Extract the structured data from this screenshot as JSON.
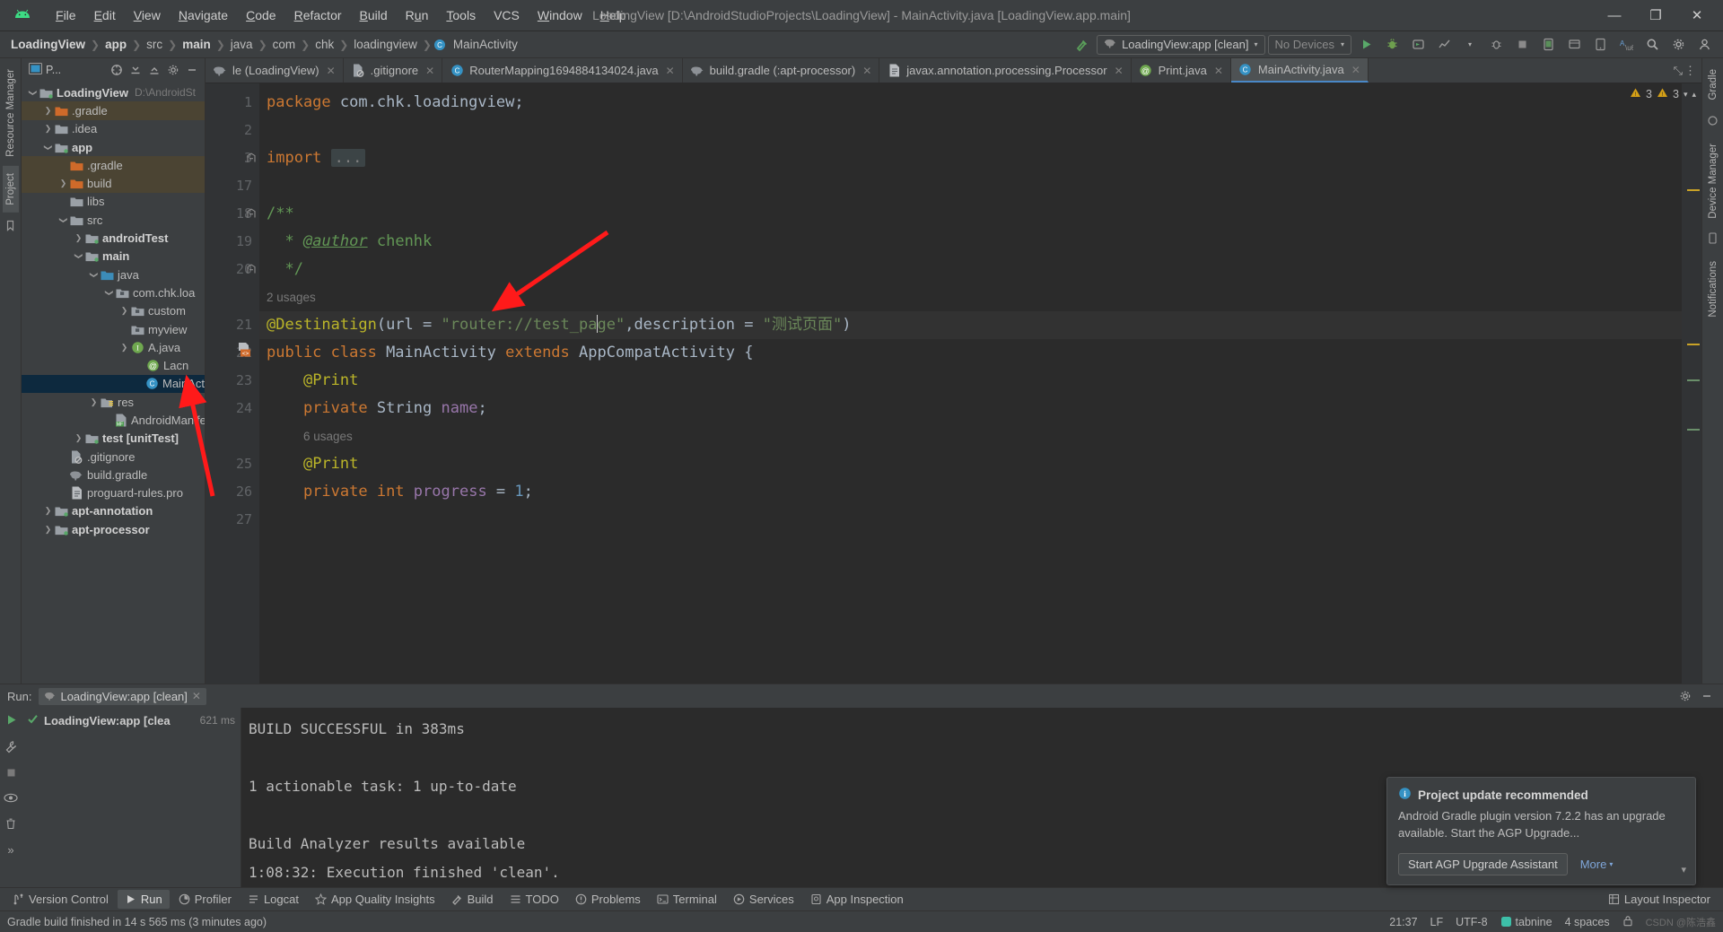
{
  "window": {
    "title": "LoadingView [D:\\AndroidStudioProjects\\LoadingView] - MainActivity.java [LoadingView.app.main]",
    "minimize": "—",
    "maximize": "❐",
    "close": "✕"
  },
  "menu": [
    "File",
    "Edit",
    "View",
    "Navigate",
    "Code",
    "Refactor",
    "Build",
    "Run",
    "Tools",
    "VCS",
    "Window",
    "Help"
  ],
  "breadcrumbs": [
    {
      "label": "LoadingView",
      "bold": true
    },
    {
      "label": "app",
      "bold": true
    },
    {
      "label": "src",
      "bold": false
    },
    {
      "label": "main",
      "bold": true
    },
    {
      "label": "java",
      "bold": false
    },
    {
      "label": "com",
      "bold": false
    },
    {
      "label": "chk",
      "bold": false
    },
    {
      "label": "loadingview",
      "bold": false
    },
    {
      "label": "MainActivity",
      "bold": false,
      "icon": "class-icon"
    }
  ],
  "toolbar": {
    "run_config": "LoadingView:app [clean]",
    "device": "No Devices",
    "caret": "▾"
  },
  "project_panel": {
    "title": "P...",
    "tree": [
      {
        "depth": 0,
        "arrow": "⌄",
        "label": "LoadingView",
        "bold": true,
        "icon": "module-icon",
        "sub": "D:\\AndroidSt",
        "state": "normal"
      },
      {
        "depth": 1,
        "arrow": "›",
        "label": ".gradle",
        "bold": false,
        "icon": "folder-orange",
        "state": "gradle"
      },
      {
        "depth": 1,
        "arrow": "›",
        "label": ".idea",
        "bold": false,
        "icon": "folder-gray",
        "state": "normal"
      },
      {
        "depth": 1,
        "arrow": "⌄",
        "label": "app",
        "bold": true,
        "icon": "module-icon",
        "state": "normal"
      },
      {
        "depth": 2,
        "arrow": "",
        "label": ".gradle",
        "bold": false,
        "icon": "folder-orange",
        "state": "gradle"
      },
      {
        "depth": 2,
        "arrow": "›",
        "label": "build",
        "bold": false,
        "icon": "folder-orange",
        "state": "gradle"
      },
      {
        "depth": 2,
        "arrow": "",
        "label": "libs",
        "bold": false,
        "icon": "folder-gray",
        "state": "normal"
      },
      {
        "depth": 2,
        "arrow": "⌄",
        "label": "src",
        "bold": false,
        "icon": "folder-gray",
        "state": "normal"
      },
      {
        "depth": 3,
        "arrow": "›",
        "label": "androidTest",
        "bold": true,
        "icon": "module-icon",
        "state": "normal"
      },
      {
        "depth": 3,
        "arrow": "⌄",
        "label": "main",
        "bold": true,
        "icon": "module-icon",
        "state": "normal"
      },
      {
        "depth": 4,
        "arrow": "⌄",
        "label": "java",
        "bold": false,
        "icon": "folder-blue",
        "state": "normal"
      },
      {
        "depth": 5,
        "arrow": "⌄",
        "label": "com.chk.loa",
        "bold": false,
        "icon": "package-icon",
        "state": "normal"
      },
      {
        "depth": 6,
        "arrow": "›",
        "label": "custom",
        "bold": false,
        "icon": "package-icon",
        "state": "normal"
      },
      {
        "depth": 6,
        "arrow": "",
        "label": "myview",
        "bold": false,
        "icon": "package-icon",
        "state": "normal"
      },
      {
        "depth": 6,
        "arrow": "›",
        "label": "A.java",
        "bold": false,
        "icon": "interface-icon",
        "state": "normal"
      },
      {
        "depth": 7,
        "arrow": "",
        "label": "Lacn",
        "bold": false,
        "icon": "annotation-icon",
        "state": "normal"
      },
      {
        "depth": 7,
        "arrow": "",
        "label": "MainActi",
        "bold": false,
        "icon": "class-icon",
        "state": "selected"
      },
      {
        "depth": 4,
        "arrow": "›",
        "label": "res",
        "bold": false,
        "icon": "res-icon",
        "state": "normal"
      },
      {
        "depth": 5,
        "arrow": "",
        "label": "AndroidManife",
        "bold": false,
        "icon": "manifest-icon",
        "state": "normal"
      },
      {
        "depth": 3,
        "arrow": "›",
        "label": "test [unitTest]",
        "bold": true,
        "icon": "module-icon",
        "state": "normal"
      },
      {
        "depth": 2,
        "arrow": "",
        "label": ".gitignore",
        "bold": false,
        "icon": "gitignore-icon",
        "state": "normal"
      },
      {
        "depth": 2,
        "arrow": "",
        "label": "build.gradle",
        "bold": false,
        "icon": "gradle-icon",
        "state": "normal"
      },
      {
        "depth": 2,
        "arrow": "",
        "label": "proguard-rules.pro",
        "bold": false,
        "icon": "file-icon",
        "state": "normal"
      },
      {
        "depth": 1,
        "arrow": "›",
        "label": "apt-annotation",
        "bold": true,
        "icon": "module-icon",
        "state": "normal"
      },
      {
        "depth": 1,
        "arrow": "›",
        "label": "apt-processor",
        "bold": true,
        "icon": "module-icon",
        "state": "normal"
      }
    ]
  },
  "left_strip": [
    "Resource Manager",
    "Project"
  ],
  "right_strip": [
    "Gradle",
    "Device Manager",
    "Notifications"
  ],
  "editor_tabs": [
    {
      "label": "le (LoadingView)",
      "icon": "gradle-icon",
      "active": false
    },
    {
      "label": ".gitignore",
      "icon": "gitignore-icon",
      "active": false
    },
    {
      "label": "RouterMapping1694884134024.java",
      "icon": "class-icon",
      "active": false
    },
    {
      "label": "build.gradle (:apt-processor)",
      "icon": "gradle-icon",
      "active": false
    },
    {
      "label": "javax.annotation.processing.Processor",
      "icon": "file-icon",
      "active": false
    },
    {
      "label": "Print.java",
      "icon": "annotation-icon",
      "active": false
    },
    {
      "label": "MainActivity.java",
      "icon": "class-icon",
      "active": true
    }
  ],
  "editor": {
    "warnings_count": "3",
    "errors_count": "3",
    "lines": [
      {
        "num": "1",
        "html": "<span class='kw'>package</span> com.chk.loadingview;"
      },
      {
        "num": "2",
        "html": ""
      },
      {
        "num": "3",
        "html": "<span class='kw'>import</span> <span class='fold-box'>...</span>"
      },
      {
        "num": "17",
        "html": ""
      },
      {
        "num": "18",
        "html": "<span class='cmt'>/**</span>"
      },
      {
        "num": "19",
        "html": "  <span class='cmt'>* <i><u>@author</u></i> chenhk</span>"
      },
      {
        "num": "20",
        "html": "  <span class='cmt'>*/</span>"
      },
      {
        "num": "",
        "html": "<span class='usages'>2 usages</span>"
      },
      {
        "num": "21",
        "html": "<span class='anno'>@Destinatign</span>(url = <span class='str'>\"router://test_pa</span>|<span class='str'>ge\"</span>,description = <span class='str'>\"测试页面\"</span>)",
        "highlighted": true
      },
      {
        "num": "22",
        "html": "<span class='kw'>public class</span> MainActivity <span class='kw'>extends</span> <span class='cls'>AppCompatActivity</span> {"
      },
      {
        "num": "23",
        "html": "    <span class='anno'>@Print</span>"
      },
      {
        "num": "24",
        "html": "    <span class='kw'>private</span> <span class='cls'>String</span> <span class='fld'>name</span>;"
      },
      {
        "num": "",
        "html": "    <span class='usages'>6 usages</span>"
      },
      {
        "num": "25",
        "html": "    <span class='anno'>@Print</span>"
      },
      {
        "num": "26",
        "html": "    <span class='kw'>private int</span> <span class='fld'>progress</span> = <span class='num'>1</span>;"
      },
      {
        "num": "27",
        "html": ""
      }
    ]
  },
  "run_panel": {
    "run_label": "Run:",
    "tab_label": "LoadingView:app [clean]",
    "tree_item": "LoadingView:app [clea",
    "tree_time": "621 ms",
    "console": [
      "BUILD SUCCESSFUL in 383ms",
      "",
      "1 actionable task: 1 up-to-date",
      "",
      "Build Analyzer results available",
      "1:08:32: Execution finished 'clean'."
    ]
  },
  "notification": {
    "title": "Project update recommended",
    "body": "Android Gradle plugin version 7.2.2 has an upgrade available. Start the AGP Upgrade...",
    "primary_button": "Start AGP Upgrade Assistant",
    "more_label": "More",
    "more_caret": "▾"
  },
  "bottom_tools": [
    {
      "label": "Version Control",
      "icon": "vcs-icon",
      "selected": false
    },
    {
      "label": "Run",
      "icon": "run-icon",
      "selected": true
    },
    {
      "label": "Profiler",
      "icon": "profiler-icon",
      "selected": false
    },
    {
      "label": "Logcat",
      "icon": "logcat-icon",
      "selected": false
    },
    {
      "label": "App Quality Insights",
      "icon": "insights-icon",
      "selected": false
    },
    {
      "label": "Build",
      "icon": "build-icon",
      "selected": false
    },
    {
      "label": "TODO",
      "icon": "todo-icon",
      "selected": false
    },
    {
      "label": "Problems",
      "icon": "problems-icon",
      "selected": false
    },
    {
      "label": "Terminal",
      "icon": "terminal-icon",
      "selected": false
    },
    {
      "label": "Services",
      "icon": "services-icon",
      "selected": false
    },
    {
      "label": "App Inspection",
      "icon": "inspection-icon",
      "selected": false
    }
  ],
  "bottom_tools_right": [
    {
      "label": "Layout Inspector",
      "icon": "layout-inspector-icon"
    }
  ],
  "statusbar": {
    "message": "Gradle build finished in 14 s 565 ms (3 minutes ago)",
    "time": "21:37",
    "line_sep": "LF",
    "encoding": "UTF-8",
    "plugin": "tabnine",
    "indent": "4 spaces",
    "lock_icon": "lock-icon",
    "watermark": "CSDN @陈浩鑫"
  }
}
